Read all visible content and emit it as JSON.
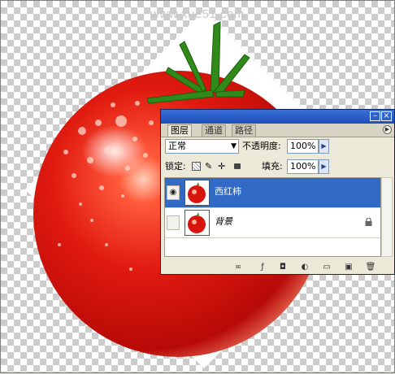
{
  "watermark": "www.xue51.com",
  "layers_panel": {
    "tabs": [
      "图层",
      "通道",
      "路径"
    ],
    "blend_mode": "正常",
    "opacity_label": "不透明度:",
    "opacity_value": "100%",
    "lock_label": "锁定:",
    "fill_label": "填充:",
    "fill_value": "100%",
    "layers": [
      {
        "name": "西红柿",
        "selected": true,
        "visible": true
      },
      {
        "name": "背景",
        "selected": false,
        "visible": false,
        "locked": true
      }
    ]
  },
  "colors": {
    "selection": "#316ac5",
    "titlebar": "#1c4fb8",
    "tomato": "#d8150c"
  }
}
